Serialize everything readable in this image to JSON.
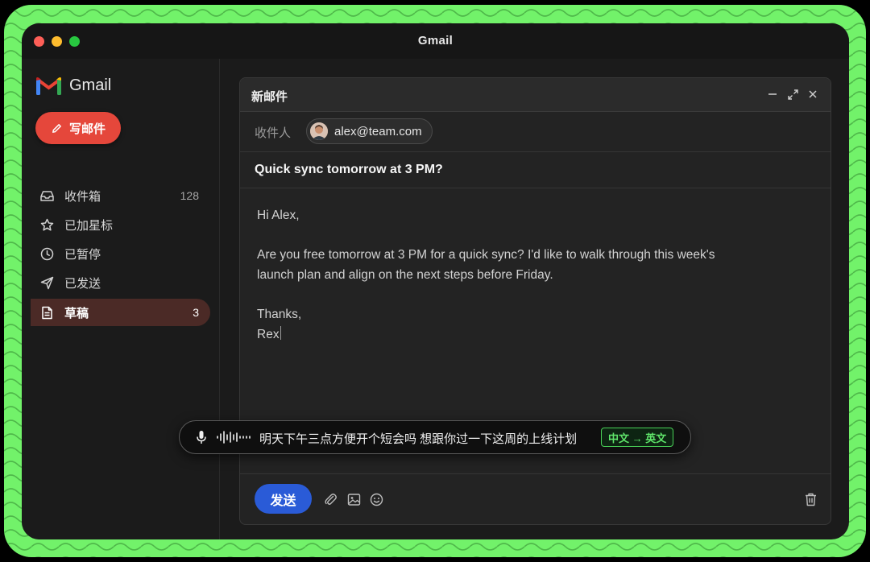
{
  "window": {
    "title": "Gmail"
  },
  "sidebar": {
    "brand": "Gmail",
    "compose_label": "写邮件",
    "items": [
      {
        "label": "收件箱",
        "count": "128",
        "icon": "inbox-icon"
      },
      {
        "label": "已加星标",
        "count": "",
        "icon": "star-icon"
      },
      {
        "label": "已暂停",
        "count": "",
        "icon": "clock-icon"
      },
      {
        "label": "已发送",
        "count": "",
        "icon": "send-icon"
      },
      {
        "label": "草稿",
        "count": "3",
        "icon": "draft-icon",
        "active": true
      }
    ]
  },
  "compose": {
    "title": "新邮件",
    "to_label": "收件人",
    "recipient": "alex@team.com",
    "subject": "Quick sync tomorrow at 3 PM?",
    "body": {
      "greeting": "Hi Alex,",
      "line1": "Are you free tomorrow at 3 PM for a quick sync? I'd like to walk through this week's",
      "line2": "launch plan and align on the next steps before Friday.",
      "closing": "Thanks,",
      "signature": "Rex"
    },
    "send_label": "发送"
  },
  "voice_input": {
    "transcript": "明天下午三点方便开个短会吗 想跟你过一下这周的上线计划",
    "translate_badge": "中文 → 英文"
  },
  "colors": {
    "frame": "#72f26a",
    "compose_button": "#e5473b",
    "send_button": "#2a5bd7",
    "active_nav": "#4b2a26",
    "badge": "#5fe46a"
  }
}
